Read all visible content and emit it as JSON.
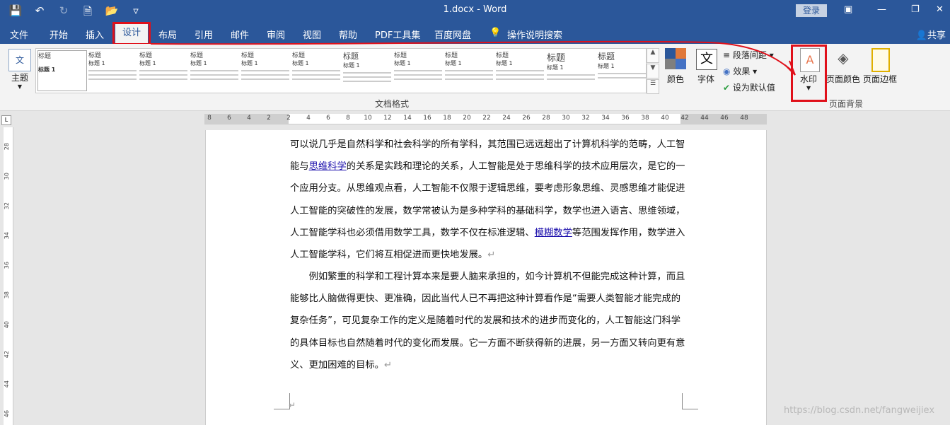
{
  "window": {
    "doc_title": "1.docx  -  Word",
    "login_label": "登录"
  },
  "quick_access": [
    "save-icon",
    "undo-icon",
    "redo-icon",
    "new-doc-icon",
    "open-icon",
    "customize-qat-icon"
  ],
  "tabs": [
    {
      "label": "文件"
    },
    {
      "label": "开始"
    },
    {
      "label": "插入"
    },
    {
      "label": "设计"
    },
    {
      "label": "布局"
    },
    {
      "label": "引用"
    },
    {
      "label": "邮件"
    },
    {
      "label": "审阅"
    },
    {
      "label": "视图"
    },
    {
      "label": "帮助"
    },
    {
      "label": "PDF工具集"
    },
    {
      "label": "百度网盘"
    },
    {
      "label": "操作说明搜索"
    }
  ],
  "share_label": "共享",
  "ribbon": {
    "theme_label": "主题",
    "theme_icon_text": "文",
    "gallery_items": [
      {
        "heading": "标题",
        "sub": "标题 1"
      },
      {
        "heading": "标题",
        "sub": "标题 1"
      },
      {
        "heading": "标题",
        "sub": "标题 1"
      },
      {
        "heading": "标题",
        "sub": "标题 1"
      },
      {
        "heading": "标题",
        "sub": "标题 1"
      },
      {
        "heading": "标题",
        "sub": "标题 1"
      },
      {
        "heading": "标题",
        "sub": "标题 1"
      },
      {
        "heading": "标题",
        "sub": "标题 1"
      },
      {
        "heading": "标题",
        "sub": "标题 1"
      },
      {
        "heading": "标题",
        "sub": "标题 1"
      },
      {
        "heading": "标题",
        "sub": "标题 1"
      },
      {
        "heading": "标题",
        "sub": "标题 1"
      }
    ],
    "doc_format_group": "文档格式",
    "colors_label": "颜色",
    "fonts_label": "字体",
    "fonts_icon_text": "文",
    "para_spacing_label": "段落间距",
    "effects_label": "效果",
    "set_default_label": "设为默认值",
    "watermark_label": "水印",
    "page_color_label": "页面颜色",
    "page_border_label": "页面边框",
    "page_bg_group": "页面背景"
  },
  "ruler": {
    "h_ticks": [
      "8",
      "6",
      "4",
      "2",
      "2",
      "4",
      "6",
      "8",
      "10",
      "12",
      "14",
      "16",
      "18",
      "20",
      "22",
      "24",
      "26",
      "28",
      "30",
      "32",
      "34",
      "36",
      "38",
      "40",
      "42",
      "44",
      "46",
      "48"
    ],
    "v_ticks": [
      "28",
      "30",
      "32",
      "34",
      "36",
      "38",
      "40",
      "42",
      "44",
      "46"
    ]
  },
  "document": {
    "p1_a": "可以说几乎是自然科学和社会科学的所有学科，其范围已远远超出了计算机科学的范畴，人工智能与",
    "p1_link1": "思维科学",
    "p1_b": "的关系是实践和理论的关系，人工智能是处于思维科学的技术应用层次，是它的一个应用分支。从思维观点看，人工智能不仅限于逻辑思维，要考虑形象思维、灵感思维才能促进人工智能的突破性的发展，数学常被认为是多种学科的基础科学，数学也进入语言、思维领域，人工智能学科也必须借用数学工具，数学不仅在标准逻辑、",
    "p1_link2": "模糊数学",
    "p1_c": "等范围发挥作用，数学进入人工智能学科，它们将互相促进而更快地发展。",
    "p2": "例如繁重的科学和工程计算本来是要人脑来承担的，如今计算机不但能完成这种计算，而且能够比人脑做得更快、更准确，因此当代人已不再把这种计算看作是“需要人类智能才能完成的复杂任务”，可见复杂工作的定义是随着时代的发展和技术的进步而变化的，人工智能这门科学的具体目标也自然随着时代的变化而发展。它一方面不断获得新的进展，另一方面又转向更有意义、更加困难的目标。",
    "para_mark": "↵"
  },
  "corner_watermark": "https://blog.csdn.net/fangweijiex",
  "colors": {
    "titlebar": "#2b579a",
    "highlight": "#e0101a",
    "link": "#1a0dab"
  }
}
